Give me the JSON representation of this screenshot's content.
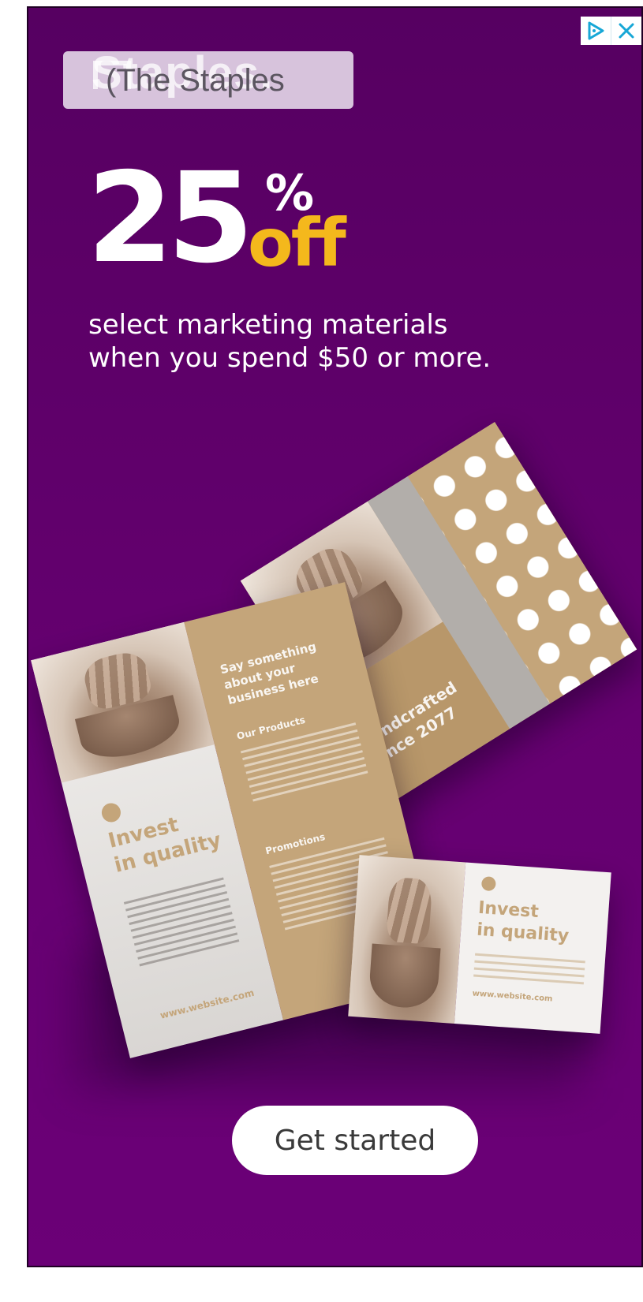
{
  "ad": {
    "adchoices_icons": [
      "adchoices-triangle-icon",
      "close-icon"
    ],
    "logo_text": "(The Staples",
    "headline_number": "25",
    "headline_percent": "%",
    "headline_off": "off",
    "subline_1": "select marketing materials",
    "subline_2": "when you spend $50 or more.",
    "cta_label": "Get started",
    "colors": {
      "background": "#5e0068",
      "accent_yellow": "#f4b81c",
      "brochure_tan": "#c4a57a",
      "button": "#ffffff"
    }
  },
  "mockups": {
    "trifold": {
      "panel_heading": "Say something about your business here",
      "products_heading": "Our Products",
      "promotions_heading": "Promotions",
      "cover_title_1": "Invest",
      "cover_title_2": "in quality",
      "url": "www.website.com"
    },
    "folded": {
      "title_1": "Handcrafted",
      "title_2": "Since 2077"
    },
    "card": {
      "title_1": "Invest",
      "title_2": "in quality",
      "url": "www.website.com"
    }
  }
}
